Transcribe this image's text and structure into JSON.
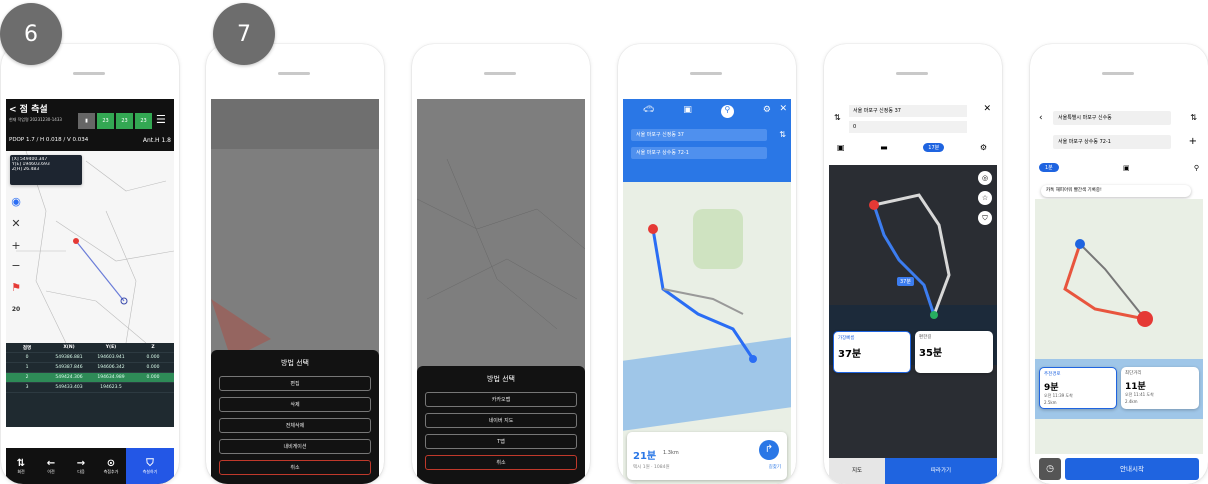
{
  "badges": [
    "6",
    "7"
  ],
  "s1": {
    "title": "< 점 측설",
    "info_line": "현재 작업명 20231230-1433",
    "pdop": "PDOP 1.7 / H 0.018 / V 0.034",
    "ant": "Ant.H 1.8",
    "coord_n": "[X] 549400.347",
    "coord_e": "Y[E] 194603.693",
    "coord_z": "Z[H] 26.483",
    "btn1": "23",
    "btn2": "23",
    "btn3": "23",
    "zoom_btn": "20",
    "table_headers": [
      "점명",
      "X(N)",
      "Y(E)",
      "Z"
    ],
    "table_rows": [
      [
        "0",
        "549386.881",
        "194603.941",
        "0.000"
      ],
      [
        "1",
        "549387.846",
        "194606.342",
        "0.000"
      ],
      [
        "2",
        "549424.306",
        "194634.989",
        "0.000"
      ],
      [
        "3",
        "549433.403",
        "194623.5",
        ""
      ]
    ],
    "footer": [
      "회전",
      "이전",
      "다음",
      "측점추가"
    ],
    "stake_label": "측설하기"
  },
  "s7": {
    "title": "방법 선택",
    "options": [
      "편집",
      "삭제",
      "전체삭제",
      "내비게이션"
    ],
    "cancel": "취소"
  },
  "s3": {
    "title": "방법 선택",
    "options": [
      "카카오맵",
      "네이버 지도",
      "T맵"
    ],
    "cancel": "취소"
  },
  "s4": {
    "from": "서울 마포구 신정동 37",
    "to": "서울 마포구 상수동 72-1",
    "time": "21분",
    "dist": "1.3km",
    "sub": "택시 1원 · 1084원",
    "go": "길찾기"
  },
  "s5": {
    "from": "서울 마포구 신정동 37",
    "to": "0",
    "tab_label": "17분",
    "opt1_tag": "가장빠름",
    "opt1_time": "37분",
    "opt2_tag": "편한길",
    "opt2_time": "35분",
    "route_tag": "37분",
    "btn_left": "지도",
    "btn_right": "따라가기"
  },
  "s6": {
    "from": "서울특별시 마포구 신수동",
    "to": "서울 마포구 상수동 72-1",
    "tab_label": "1분",
    "notice": "카톡 해피아워 빨간색 기록중!",
    "opt1_tag": "추천경로",
    "opt1_time": "9분",
    "opt1_sub": "오전 11:39 도착",
    "opt1_dist": "2.5km",
    "opt2_tag": "최단거리",
    "opt2_time": "11분",
    "opt2_sub": "오전 11:41 도착",
    "opt2_dist": "2.4km",
    "start": "안내시작"
  },
  "colors": {
    "accent_green": "#33a853",
    "kakao_blue": "#2a77e6",
    "navy_btn": "#1f64e0",
    "dark_map": "#2a2d33"
  }
}
